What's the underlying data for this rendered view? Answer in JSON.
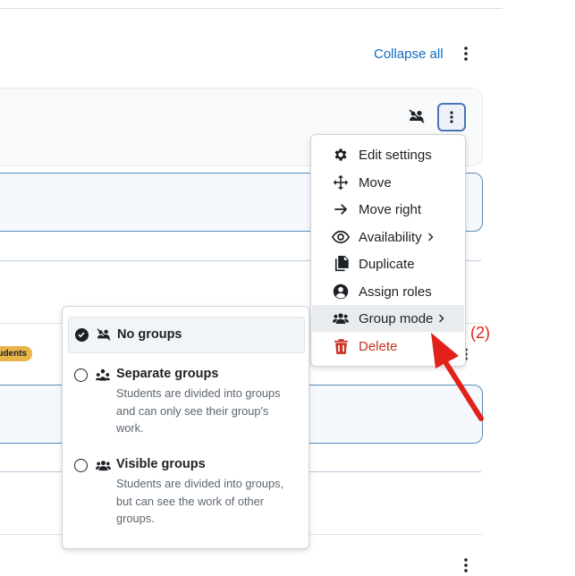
{
  "course_header": {
    "collapse_all": "Collapse all"
  },
  "badge": {
    "label": "tudents"
  },
  "action_menu": {
    "items": [
      {
        "label": "Edit settings",
        "icon": "gear-icon"
      },
      {
        "label": "Move",
        "icon": "move-icon"
      },
      {
        "label": "Move right",
        "icon": "arrow-right-icon"
      },
      {
        "label": "Availability",
        "icon": "eye-icon",
        "has_submenu": true
      },
      {
        "label": "Duplicate",
        "icon": "copy-icon"
      },
      {
        "label": "Assign roles",
        "icon": "user-circle-icon"
      },
      {
        "label": "Group mode",
        "icon": "users-icon",
        "has_submenu": true,
        "active": true
      },
      {
        "label": "Delete",
        "icon": "trash-icon",
        "danger": true
      }
    ]
  },
  "group_mode_menu": {
    "options": [
      {
        "title": "No groups",
        "description": "",
        "selected": true
      },
      {
        "title": "Separate groups",
        "description": "Students are divided into groups and can only see their group's work.",
        "selected": false
      },
      {
        "title": "Visible groups",
        "description": "Students are divided into groups, but can see the work of other groups.",
        "selected": false
      }
    ]
  },
  "annotation": {
    "step_label": "(2)"
  },
  "colors": {
    "link": "#0f6cbf",
    "danger": "#ca3120",
    "annotation": "#e0221b",
    "badge": "#e9b54a"
  }
}
